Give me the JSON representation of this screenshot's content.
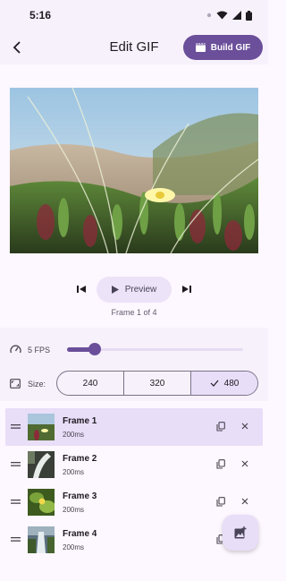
{
  "status_bar": {
    "time": "5:16"
  },
  "app_bar": {
    "title": "Edit GIF",
    "build_label": "Build GIF"
  },
  "player": {
    "preview_label": "Preview",
    "frame_counter": "Frame 1 of 4"
  },
  "settings": {
    "fps_label": "5 FPS",
    "fps_slider": {
      "value": 5,
      "min": 1,
      "max": 30
    },
    "size_label": "Size:",
    "size_options": [
      "240",
      "320",
      "480"
    ],
    "size_selected": "480"
  },
  "frames": [
    {
      "name": "Frame 1",
      "duration": "200ms"
    },
    {
      "name": "Frame 2",
      "duration": "200ms"
    },
    {
      "name": "Frame 3",
      "duration": "200ms"
    },
    {
      "name": "Frame 4",
      "duration": "200ms"
    }
  ],
  "colors": {
    "accent": "#6b4f9a",
    "selected_bg": "#e8def8",
    "surface": "#f7f1fb"
  }
}
